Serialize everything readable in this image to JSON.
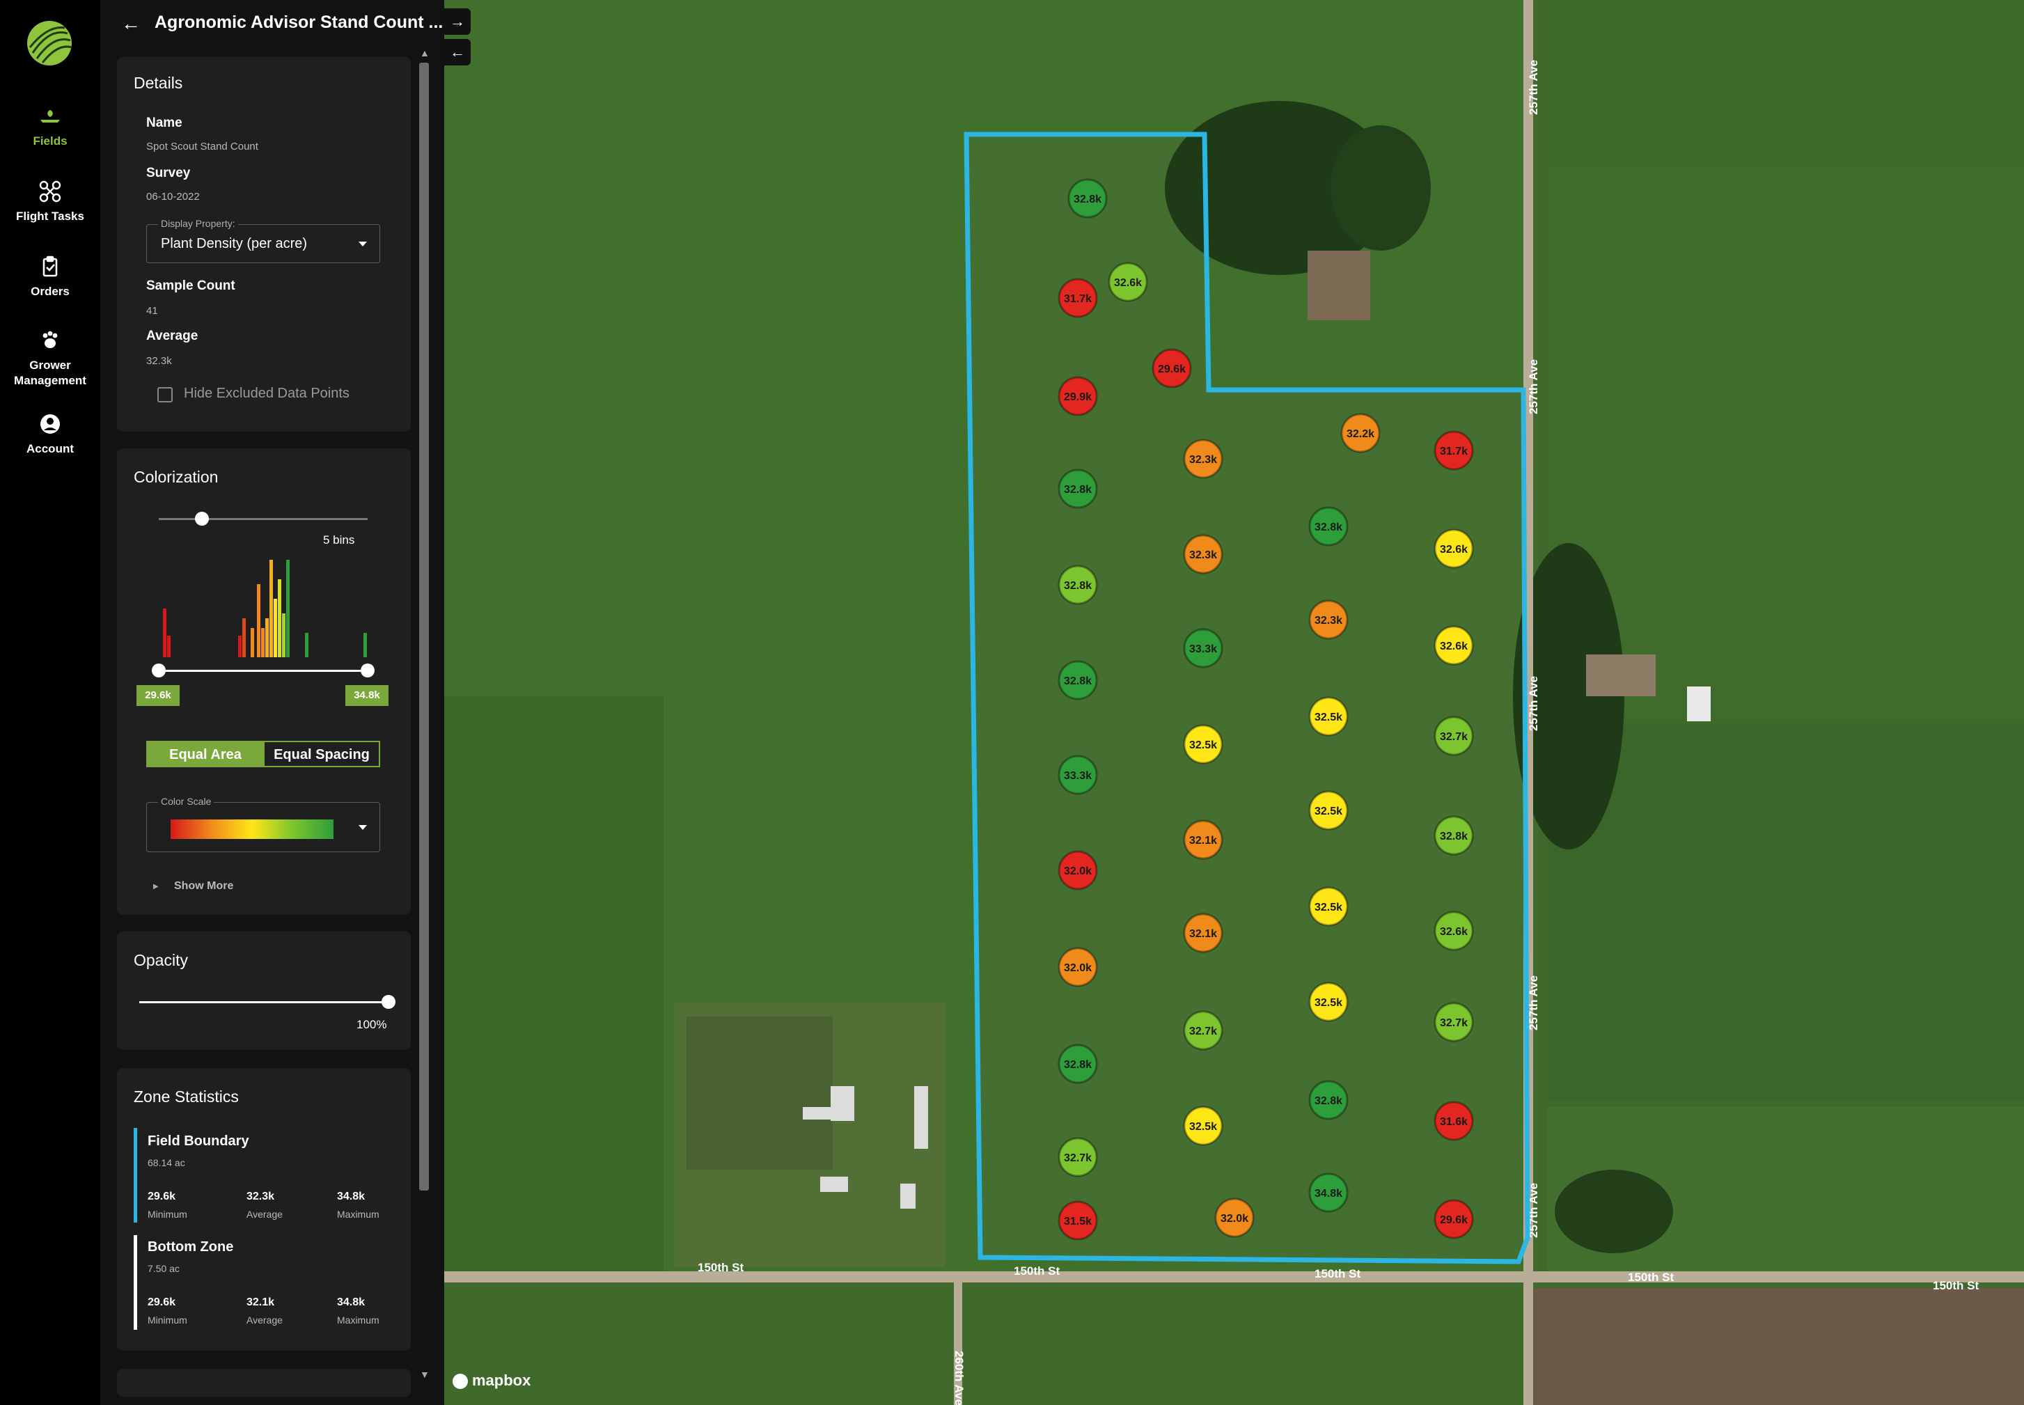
{
  "nav": {
    "items": [
      {
        "label": "Fields",
        "icon": "fields-icon",
        "active": true
      },
      {
        "label": "Flight Tasks",
        "icon": "drone-icon",
        "active": false
      },
      {
        "label": "Orders",
        "icon": "clipboard-icon",
        "active": false
      },
      {
        "label": "Grower Management",
        "icon": "paw-icon",
        "active": false
      },
      {
        "label": "Account",
        "icon": "account-icon",
        "active": false
      }
    ]
  },
  "header": {
    "title": "Agronomic Advisor Stand Count ..."
  },
  "details": {
    "heading": "Details",
    "name_label": "Name",
    "name_value": "Spot Scout Stand Count",
    "survey_label": "Survey",
    "survey_value": "06-10-2022",
    "display_property_legend": "Display Property:",
    "display_property_value": "Plant Density (per acre)",
    "sample_count_label": "Sample Count",
    "sample_count_value": "41",
    "average_label": "Average",
    "average_value": "32.3k",
    "hide_excluded_label": "Hide Excluded Data Points"
  },
  "colorization": {
    "heading": "Colorization",
    "bins_label": "5 bins",
    "bins_value": 5,
    "range_min_label": "29.6k",
    "range_max_label": "34.8k",
    "toggle_equal_area": "Equal Area",
    "toggle_equal_spacing": "Equal Spacing",
    "selected_mode": "Equal Area",
    "color_scale_legend": "Color Scale",
    "show_more_label": "Show More",
    "histogram": [
      {
        "pos": 0.02,
        "h": 0.5,
        "c": "#d7191c"
      },
      {
        "pos": 0.04,
        "h": 0.22,
        "c": "#d7191c"
      },
      {
        "pos": 0.38,
        "h": 0.22,
        "c": "#d7191c"
      },
      {
        "pos": 0.4,
        "h": 0.4,
        "c": "#e04a1a"
      },
      {
        "pos": 0.44,
        "h": 0.3,
        "c": "#f08a1b"
      },
      {
        "pos": 0.47,
        "h": 0.75,
        "c": "#f08a1b"
      },
      {
        "pos": 0.49,
        "h": 0.3,
        "c": "#f08a1b"
      },
      {
        "pos": 0.51,
        "h": 0.4,
        "c": "#f2b21b"
      },
      {
        "pos": 0.53,
        "h": 1.0,
        "c": "#f2b21b"
      },
      {
        "pos": 0.55,
        "h": 0.6,
        "c": "#ffe617"
      },
      {
        "pos": 0.57,
        "h": 0.8,
        "c": "#d7e21b"
      },
      {
        "pos": 0.59,
        "h": 0.45,
        "c": "#a6d32a"
      },
      {
        "pos": 0.61,
        "h": 1.0,
        "c": "#2e9e3a"
      },
      {
        "pos": 0.7,
        "h": 0.25,
        "c": "#2e9e3a"
      },
      {
        "pos": 0.98,
        "h": 0.25,
        "c": "#2e9e3a"
      }
    ]
  },
  "opacity": {
    "heading": "Opacity",
    "value_label": "100%",
    "value": 1.0
  },
  "zone_statistics": {
    "heading": "Zone Statistics",
    "zones": [
      {
        "name": "Field Boundary",
        "area": "68.14 ac",
        "min": "29.6k",
        "avg": "32.3k",
        "max": "34.8k",
        "color": "#2bb6e4"
      },
      {
        "name": "Bottom Zone",
        "area": "7.50 ac",
        "min": "29.6k",
        "avg": "32.1k",
        "max": "34.8k",
        "color": "#ffffff"
      }
    ],
    "min_label": "Minimum",
    "avg_label": "Average",
    "max_label": "Maximum"
  },
  "map": {
    "roads": {
      "ave_257": "257th Ave",
      "st_150": "150th St",
      "ave_260": "260th Ave"
    },
    "attribution": "mapbox",
    "boundary_color": "#2bb6e4",
    "points": [
      {
        "label": "32.8k",
        "color": "#2e9e3a"
      },
      {
        "label": "32.6k",
        "color": "#7cc52e"
      },
      {
        "label": "31.7k",
        "color": "#e3261f"
      },
      {
        "label": "29.6k",
        "color": "#e3261f"
      },
      {
        "label": "29.9k",
        "color": "#e3261f"
      },
      {
        "label": "32.2k",
        "color": "#f08a1b"
      },
      {
        "label": "31.7k",
        "color": "#e3261f"
      },
      {
        "label": "32.3k",
        "color": "#f08a1b"
      },
      {
        "label": "32.8k",
        "color": "#2e9e3a"
      },
      {
        "label": "32.8k",
        "color": "#2e9e3a"
      },
      {
        "label": "32.3k",
        "color": "#f08a1b"
      },
      {
        "label": "32.6k",
        "color": "#ffe617"
      },
      {
        "label": "32.8k",
        "color": "#7cc52e"
      },
      {
        "label": "32.3k",
        "color": "#f08a1b"
      },
      {
        "label": "33.3k",
        "color": "#2e9e3a"
      },
      {
        "label": "32.6k",
        "color": "#ffe617"
      },
      {
        "label": "32.8k",
        "color": "#2e9e3a"
      },
      {
        "label": "32.5k",
        "color": "#ffe617"
      },
      {
        "label": "32.5k",
        "color": "#ffe617"
      },
      {
        "label": "32.7k",
        "color": "#7cc52e"
      },
      {
        "label": "33.3k",
        "color": "#2e9e3a"
      },
      {
        "label": "32.5k",
        "color": "#ffe617"
      },
      {
        "label": "32.1k",
        "color": "#f08a1b"
      },
      {
        "label": "32.8k",
        "color": "#7cc52e"
      },
      {
        "label": "32.0k",
        "color": "#e3261f"
      },
      {
        "label": "32.5k",
        "color": "#ffe617"
      },
      {
        "label": "32.1k",
        "color": "#f08a1b"
      },
      {
        "label": "32.6k",
        "color": "#7cc52e"
      },
      {
        "label": "32.0k",
        "color": "#f08a1b"
      },
      {
        "label": "32.5k",
        "color": "#ffe617"
      },
      {
        "label": "32.7k",
        "color": "#7cc52e"
      },
      {
        "label": "32.7k",
        "color": "#7cc52e"
      },
      {
        "label": "32.8k",
        "color": "#2e9e3a"
      },
      {
        "label": "32.8k",
        "color": "#2e9e3a"
      },
      {
        "label": "31.6k",
        "color": "#e3261f"
      },
      {
        "label": "32.5k",
        "color": "#ffe617"
      },
      {
        "label": "32.7k",
        "color": "#7cc52e"
      },
      {
        "label": "34.8k",
        "color": "#2e9e3a"
      },
      {
        "label": "31.5k",
        "color": "#e3261f"
      },
      {
        "label": "32.0k",
        "color": "#f08a1b"
      },
      {
        "label": "29.6k",
        "color": "#e3261f"
      }
    ]
  },
  "colors": {
    "accent": "#8fc43c",
    "panel": "#1f1f1f",
    "sidebar": "#121212"
  }
}
